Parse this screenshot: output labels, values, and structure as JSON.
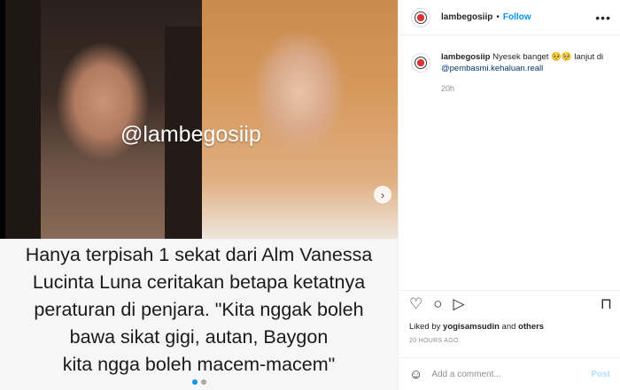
{
  "media": {
    "watermark": "@lambegosiip",
    "caption_lines": [
      "Hanya terpisah 1 sekat dari Alm Vanessa",
      "Lucinta Luna ceritakan betapa ketatnya",
      "peraturan di penjara. \"Kita nggak boleh",
      "bawa sikat gigi, autan, Baygon",
      "kita ngga boleh macem-macem\""
    ],
    "next_icon": "›",
    "carousel_dots": 2,
    "active_dot": 1
  },
  "header": {
    "username": "lambegosiip",
    "bullet": "•",
    "follow_label": "Follow",
    "more_icon": "•••"
  },
  "comment": {
    "username": "lambegosiip",
    "text_before": " Nyesek banget 🥺🥺 lanjut di ",
    "mention": "@pembasmi.kehaluan.reall",
    "time": "20h"
  },
  "actions": {
    "like_icon": "♡",
    "comment_icon": "○",
    "share_icon": "▷",
    "save_icon": "⊓"
  },
  "likes": {
    "prefix": "Liked by ",
    "user": "yogisamsudin",
    "middle": " and ",
    "others": "others"
  },
  "post_age": "20 HOURS AGO",
  "add_comment": {
    "emoji_icon": "☺",
    "placeholder": "Add a comment...",
    "post_label": "Post"
  },
  "colors": {
    "accent": "#0095f6",
    "mention": "#00376b",
    "muted": "#8e8e8e",
    "post_disabled": "#b2dffc"
  }
}
